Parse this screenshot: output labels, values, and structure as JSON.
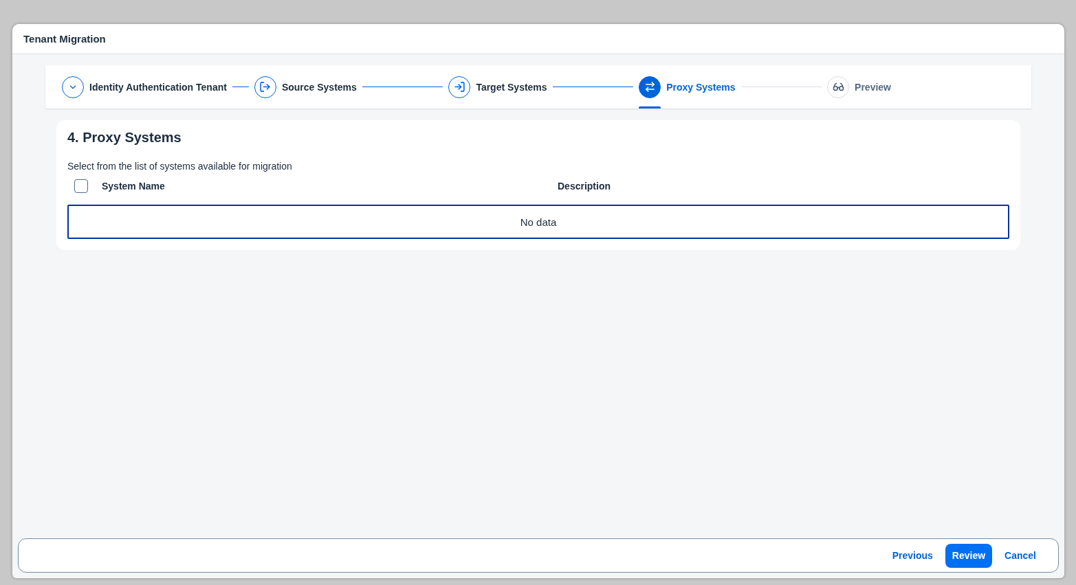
{
  "dialog": {
    "title": "Tenant Migration"
  },
  "steps": [
    {
      "label": "Identity Authentication Tenant",
      "completed": true,
      "selected": false
    },
    {
      "label": "Source Systems",
      "completed": true,
      "selected": false
    },
    {
      "label": "Target Systems",
      "completed": true,
      "selected": false
    },
    {
      "label": "Proxy Systems",
      "completed": false,
      "selected": true
    },
    {
      "label": "Preview",
      "completed": false,
      "selected": false
    }
  ],
  "section": {
    "heading": "4. Proxy Systems",
    "description": "Select from the list of systems available for migration"
  },
  "table": {
    "select_all_checked": false,
    "columns": [
      "System Name",
      "Description"
    ],
    "empty_text": "No data"
  },
  "footer": {
    "buttons": [
      {
        "label": "Previous",
        "kind": "transparent"
      },
      {
        "label": "Review",
        "kind": "emphasized"
      },
      {
        "label": "Cancel",
        "kind": "transparent"
      }
    ]
  }
}
